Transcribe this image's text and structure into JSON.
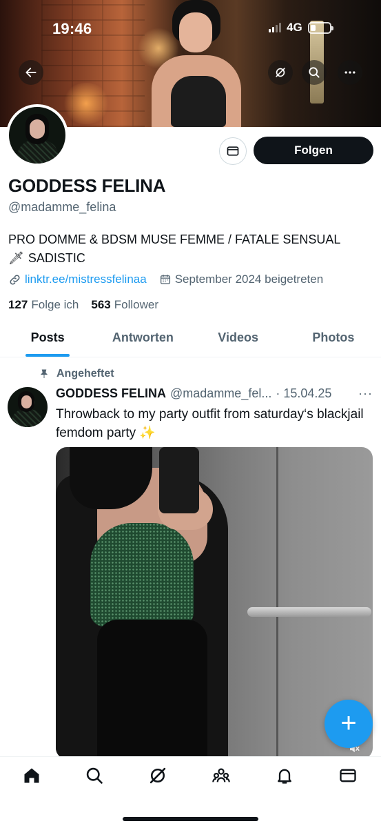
{
  "status_bar": {
    "time": "19:46",
    "network": "4G"
  },
  "profile": {
    "display_name": "GODDESS FELINA",
    "handle": "@madamme_felina",
    "follow_label": "Folgen",
    "bio_line1": "PRO DOMME & BDSM MUSE FEMME / FATALE SENSUAL",
    "bio_emoji": "🗡",
    "bio_line2": "SADISTIC",
    "link": "linktr.ee/mistressfelinaa",
    "joined": "September 2024 beigetreten",
    "following_count": "127",
    "following_label": "Folge ich",
    "followers_count": "563",
    "followers_label": "Follower"
  },
  "tabs": [
    {
      "label": "Posts",
      "active": true
    },
    {
      "label": "Antworten",
      "active": false
    },
    {
      "label": "Videos",
      "active": false
    },
    {
      "label": "Photos",
      "active": false
    }
  ],
  "post": {
    "pinned_label": "Angeheftet",
    "author_name": "GODDESS FELINA",
    "author_handle": "@madamme_fel...",
    "date": "· 15.04.25",
    "more": "···",
    "text": "Throwback to my party outfit from saturday‘s blackjail femdom party ✨"
  },
  "fab": {
    "label": "+"
  },
  "icons": {
    "back": "arrow-left-icon",
    "grok": "grok-icon",
    "search": "search-icon",
    "more": "more-icon",
    "message": "envelope-icon",
    "link": "link-icon",
    "calendar": "calendar-icon",
    "pin": "pin-icon",
    "mute": "speaker-muted-icon"
  },
  "colors": {
    "accent": "#1d9bf0",
    "text": "#0f1419",
    "secondary": "#536471",
    "follow_bg": "#0f1419"
  }
}
